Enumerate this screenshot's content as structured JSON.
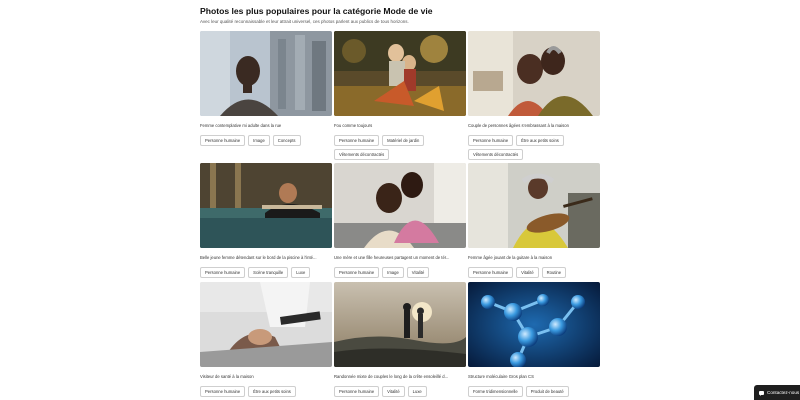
{
  "header": {
    "title": "Photos les plus populaires pour la catégorie Mode de vie",
    "subtitle": "Avec leur qualité reconnaissable et leur attrait universel, ces photos parlent aux publics de tous horizons."
  },
  "cards": [
    {
      "caption": "Femme contemplative mi adulte dans la rue",
      "tags": [
        "Personne humaine",
        "Image",
        "Concepts"
      ]
    },
    {
      "caption": "Fou comme toujours",
      "tags": [
        "Personne humaine",
        "Matériel de jardin",
        "Vêtements décontractés"
      ]
    },
    {
      "caption": "Couple de personnes âgées s'embrassant à la maison",
      "tags": [
        "Personne humaine",
        "Être aux petits soins",
        "Vêtements décontractés"
      ]
    },
    {
      "caption": "Belle jeune femme détendant sur le bord de la piscine à l'inté...",
      "tags": [
        "Personne humaine",
        "Scène tranquille",
        "Luxe"
      ]
    },
    {
      "caption": "Une mère et une fille heureuses partagent un moment de tér...",
      "tags": [
        "Personne humaine",
        "Image",
        "Vitalité"
      ]
    },
    {
      "caption": "Femme âgée jouant de la guitare à la maison",
      "tags": [
        "Personne humaine",
        "Vitalité",
        "Routine"
      ]
    },
    {
      "caption": "Visiteur de santé à la maison",
      "tags": [
        "Personne humaine",
        "Être aux petits soins"
      ]
    },
    {
      "caption": "Randonnée mixte de couples le long de la crête ensoleillé d...",
      "tags": [
        "Personne humaine",
        "Vitalité",
        "Luxe"
      ]
    },
    {
      "caption": "Structure moléculaire Gros plan CS",
      "tags": [
        "Forme tridimensionnelle",
        "Produit de beauté"
      ]
    }
  ],
  "contact_button": {
    "label": "Contactez-nous",
    "icon": "chat-bubble-icon"
  }
}
